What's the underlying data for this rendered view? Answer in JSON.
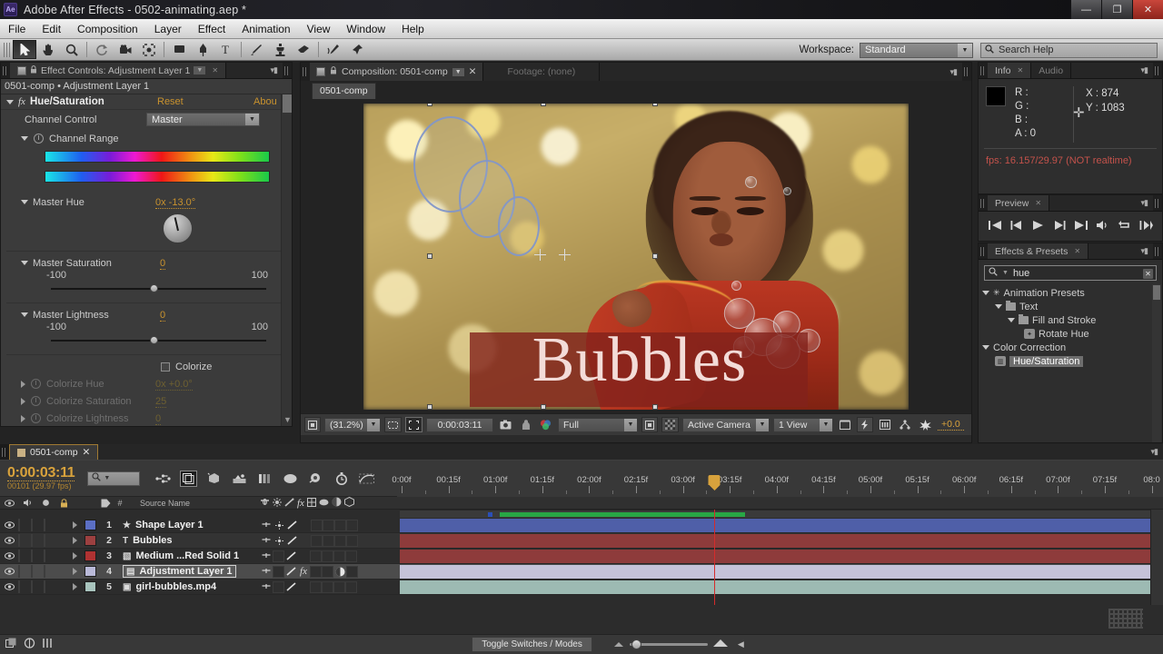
{
  "window": {
    "title": "Adobe After Effects - 0502-animating.aep *",
    "logo": "Ae",
    "controls": {
      "minimize": "—",
      "maximize": "❐",
      "close": "✕"
    }
  },
  "menubar": {
    "items": [
      "File",
      "Edit",
      "Composition",
      "Layer",
      "Effect",
      "Animation",
      "View",
      "Window",
      "Help"
    ]
  },
  "toolbar": {
    "tools": [
      {
        "name": "selection-tool",
        "selected": true
      },
      {
        "name": "hand-tool",
        "selected": false
      },
      {
        "name": "zoom-tool",
        "selected": false
      },
      {
        "name": "rotation-tool",
        "selected": false
      },
      {
        "name": "camera-tool",
        "selected": false
      },
      {
        "name": "pan-behind-tool",
        "selected": false
      },
      {
        "name": "shape-tool",
        "selected": false
      },
      {
        "name": "pen-tool",
        "selected": false
      },
      {
        "name": "type-tool",
        "selected": false
      },
      {
        "name": "brush-tool",
        "selected": false
      },
      {
        "name": "clone-stamp-tool",
        "selected": false
      },
      {
        "name": "eraser-tool",
        "selected": false
      },
      {
        "name": "roto-brush-tool",
        "selected": false
      },
      {
        "name": "puppet-pin-tool",
        "selected": false
      }
    ],
    "workspace_label": "Workspace:",
    "workspace_value": "Standard",
    "search_help_placeholder": "Search Help"
  },
  "effect_controls": {
    "tab_title": "Effect Controls: Adjustment Layer 1",
    "subtitle": "0501-comp • Adjustment Layer 1",
    "effect_name": "Hue/Saturation",
    "fx_badge": "fx",
    "reset_link": "Reset",
    "about_link": "Abou",
    "channel_control_label": "Channel Control",
    "channel_control_value": "Master",
    "channel_range_label": "Channel Range",
    "master_hue_label": "Master Hue",
    "master_hue_value": "0x -13.0°",
    "master_saturation_label": "Master Saturation",
    "master_saturation_value": "0",
    "master_saturation_min": "-100",
    "master_saturation_max": "100",
    "master_lightness_label": "Master Lightness",
    "master_lightness_value": "0",
    "master_lightness_min": "-100",
    "master_lightness_max": "100",
    "colorize_label": "Colorize",
    "colorize_hue_label": "Colorize Hue",
    "colorize_hue_value": "0x +0.0°",
    "colorize_saturation_label": "Colorize Saturation",
    "colorize_saturation_value": "25",
    "colorize_lightness_label": "Colorize Lightness",
    "colorize_lightness_value": "0"
  },
  "composition": {
    "tab_active": "Composition: 0501-comp",
    "tab_inactive": "Footage: (none)",
    "subtab": "0501-comp",
    "artwork": {
      "title_text": "Bubbles",
      "title_box_color": "#82221c",
      "title_text_color": "#f3dcd8"
    },
    "bottom_bar": {
      "magnification": "(31.2%)",
      "timecode": "0:00:03:11",
      "resolution": "Full",
      "camera": "Active Camera",
      "views": "1 View",
      "exposure": "+0.0"
    }
  },
  "info": {
    "tab": "Info",
    "tab_inactive": "Audio",
    "r_label": "R :",
    "g_label": "G :",
    "b_label": "B :",
    "a_label": "A :",
    "a_value": "0",
    "x_label": "X : 874",
    "y_label": "Y : 1083",
    "fps_text": "fps: 16.157/29.97 (NOT realtime)",
    "fps_color": "#c4524b"
  },
  "preview": {
    "tab": "Preview",
    "buttons": [
      "first-frame",
      "previous-frame",
      "play",
      "next-frame",
      "last-frame",
      "audio",
      "loop",
      "ram-preview"
    ]
  },
  "effects_presets": {
    "tab": "Effects & Presets",
    "search_value": "hue",
    "tree": [
      {
        "label": "Animation Presets",
        "indent": 0,
        "icon": "asterisk",
        "expanded": true
      },
      {
        "label": "Text",
        "indent": 1,
        "icon": "folder",
        "expanded": true
      },
      {
        "label": "Fill and Stroke",
        "indent": 2,
        "icon": "folder",
        "expanded": true
      },
      {
        "label": "Rotate Hue",
        "indent": 3,
        "icon": "preset",
        "expanded": false
      },
      {
        "label": "Color Correction",
        "indent": 0,
        "icon": "none",
        "expanded": true
      },
      {
        "label": "Hue/Saturation",
        "indent": 1,
        "icon": "effect",
        "expanded": false,
        "selected": true
      }
    ]
  },
  "timeline": {
    "tab": "0501-comp",
    "current_time": "0:00:03:11",
    "frame_info": "00101 (29.97 fps)",
    "search_placeholder": "",
    "column_header": "Source Name",
    "layers": [
      {
        "index": "1",
        "name": "Shape Layer 1",
        "color": "#5b6fc4",
        "type": "shape",
        "bar_color": "#4f5fa8",
        "selected": false,
        "has_fx": false
      },
      {
        "index": "2",
        "name": "Bubbles",
        "color": "#9c4040",
        "type": "text",
        "bar_color": "#8e3b3b",
        "selected": false,
        "has_fx": false
      },
      {
        "index": "3",
        "name": "Medium ...Red Solid 1",
        "color": "#b03232",
        "type": "solid",
        "bar_color": "#8e3b3b",
        "selected": false,
        "has_fx": false
      },
      {
        "index": "4",
        "name": "Adjustment Layer 1",
        "color": "#b9b9d8",
        "type": "adjustment",
        "bar_color": "#c5c2d8",
        "selected": true,
        "has_fx": true
      },
      {
        "index": "5",
        "name": "girl-bubbles.mp4",
        "color": "#a8c4bd",
        "type": "footage",
        "bar_color": "#9dbab3",
        "selected": false,
        "has_fx": false
      }
    ],
    "ruler_labels": [
      "0:00f",
      "00:15f",
      "01:00f",
      "01:15f",
      "02:00f",
      "02:15f",
      "03:00f",
      "03:15f",
      "04:00f",
      "04:15f",
      "05:00f",
      "05:15f",
      "06:00f",
      "06:15f",
      "07:00f",
      "07:15f",
      "08:0"
    ],
    "playhead_label": "03:15f",
    "toggle_switches_label": "Toggle Switches / Modes"
  }
}
